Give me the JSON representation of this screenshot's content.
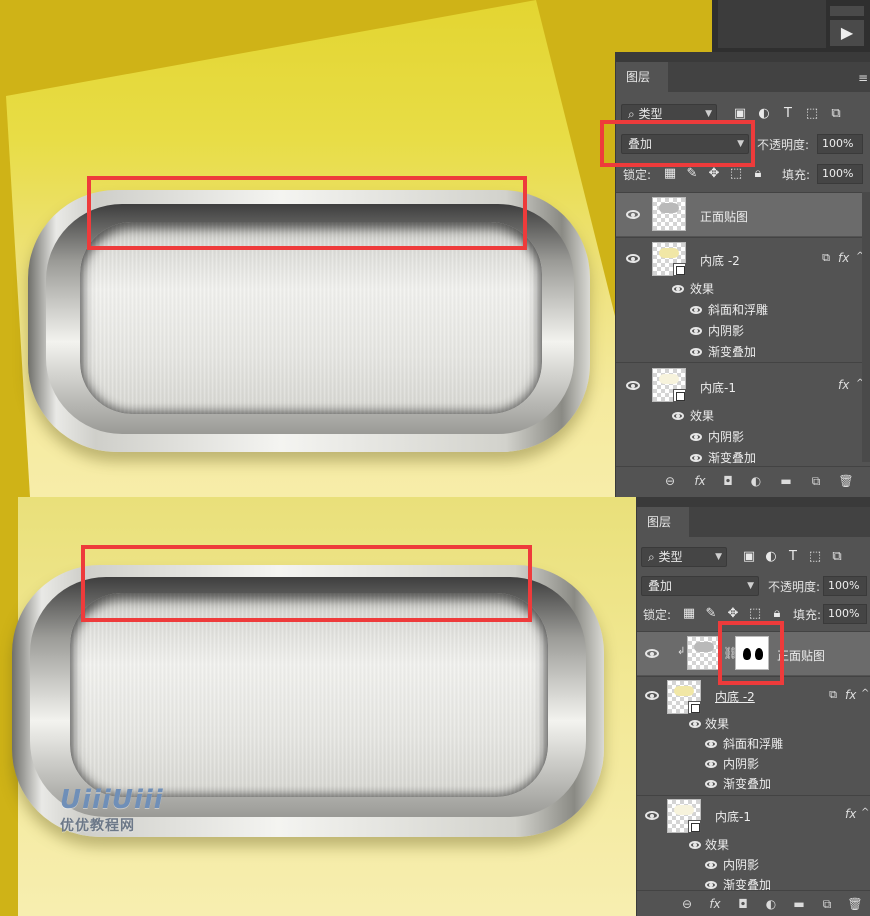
{
  "colors": {
    "canvas_yellow": "#cfb317",
    "panel_bg": "#535353",
    "highlight_red": "#ee3b3b",
    "selected_row": "#6b6b6b"
  },
  "top_panel": {
    "tab_title": "图层",
    "filter_label": "类型",
    "blend_mode": "叠加",
    "opacity_label": "不透明度:",
    "opacity_value": "100%",
    "lock_label": "锁定:",
    "fill_label": "填充:",
    "fill_value": "100%",
    "layers": [
      {
        "name": "正面贴图",
        "selected": true
      },
      {
        "name": "内底 -2",
        "fx": "fx",
        "effects_label": "效果",
        "effects": [
          "斜面和浮雕",
          "内阴影",
          "渐变叠加"
        ]
      },
      {
        "name": "内底-1",
        "fx": "fx",
        "effects_label": "效果",
        "effects": [
          "内阴影",
          "渐变叠加"
        ]
      }
    ]
  },
  "bottom_panel": {
    "tab_title": "图层",
    "filter_label": "类型",
    "blend_mode": "叠加",
    "opacity_label": "不透明度:",
    "opacity_value": "100%",
    "lock_label": "锁定:",
    "fill_label": "填充:",
    "fill_value": "100%",
    "layers": [
      {
        "name": "正面贴图",
        "selected": true
      },
      {
        "name": "内底 -2",
        "fx": "fx",
        "effects_label": "效果",
        "effects": [
          "斜面和浮雕",
          "内阴影",
          "渐变叠加"
        ]
      },
      {
        "name": "内底-1",
        "fx": "fx",
        "effects_label": "效果",
        "effects": [
          "内阴影",
          "渐变叠加"
        ]
      }
    ]
  },
  "watermark": {
    "logo": "UiiiUiii",
    "site": "优优教程网"
  }
}
